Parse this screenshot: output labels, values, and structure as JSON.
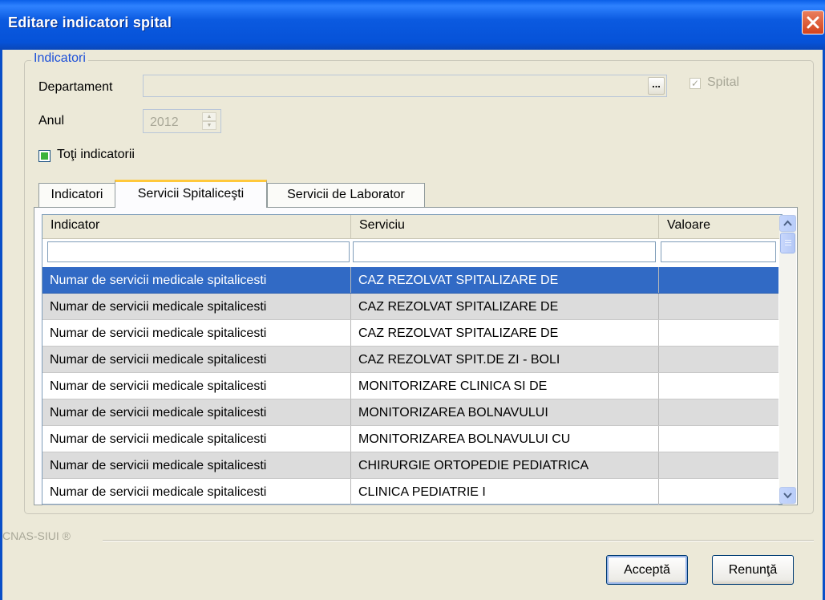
{
  "window": {
    "title": "Editare indicatori spital"
  },
  "group": {
    "legend": "Indicatori",
    "departament_label": "Departament",
    "departament_value": "",
    "browse_label": "...",
    "spital_label": "Spital",
    "spital_checked": true,
    "anul_label": "Anul",
    "anul_value": "2012",
    "toti_label": "Toţi indicatorii"
  },
  "tabs": [
    {
      "label": "Indicatori",
      "active": false
    },
    {
      "label": "Servicii Spitaliceşti",
      "active": true
    },
    {
      "label": "Servicii de Laborator",
      "active": false
    }
  ],
  "grid": {
    "columns": [
      "Indicator",
      "Serviciu",
      "Valoare"
    ],
    "filters": [
      "",
      "",
      ""
    ],
    "rows": [
      [
        "Numar de servicii medicale spitalicesti",
        "CAZ REZOLVAT SPITALIZARE DE",
        ""
      ],
      [
        "Numar de servicii medicale spitalicesti",
        "CAZ REZOLVAT SPITALIZARE DE",
        ""
      ],
      [
        "Numar de servicii medicale spitalicesti",
        "CAZ REZOLVAT SPITALIZARE DE",
        ""
      ],
      [
        "Numar de servicii medicale spitalicesti",
        "CAZ REZOLVAT SPIT.DE ZI - BOLI",
        ""
      ],
      [
        "Numar de servicii medicale spitalicesti",
        "MONITORIZARE CLINICA SI DE",
        ""
      ],
      [
        "Numar de servicii medicale spitalicesti",
        "MONITORIZAREA BOLNAVULUI",
        ""
      ],
      [
        "Numar de servicii medicale spitalicesti",
        "MONITORIZAREA BOLNAVULUI CU",
        ""
      ],
      [
        "Numar de servicii medicale spitalicesti",
        "CHIRURGIE ORTOPEDIE PEDIATRICA",
        ""
      ],
      [
        "Numar de servicii medicale spitalicesti",
        "CLINICA PEDIATRIE I",
        ""
      ]
    ],
    "selected_row": 0
  },
  "footer": {
    "brand": "CNAS-SIUI ®",
    "accept_label": "Acceptă",
    "cancel_label": "Renunţă"
  },
  "colors": {
    "titlebar": "#0652d8",
    "selection": "#316ac5",
    "group_legend": "#1c4fd8",
    "active_tab_accent": "#ffc83c"
  }
}
